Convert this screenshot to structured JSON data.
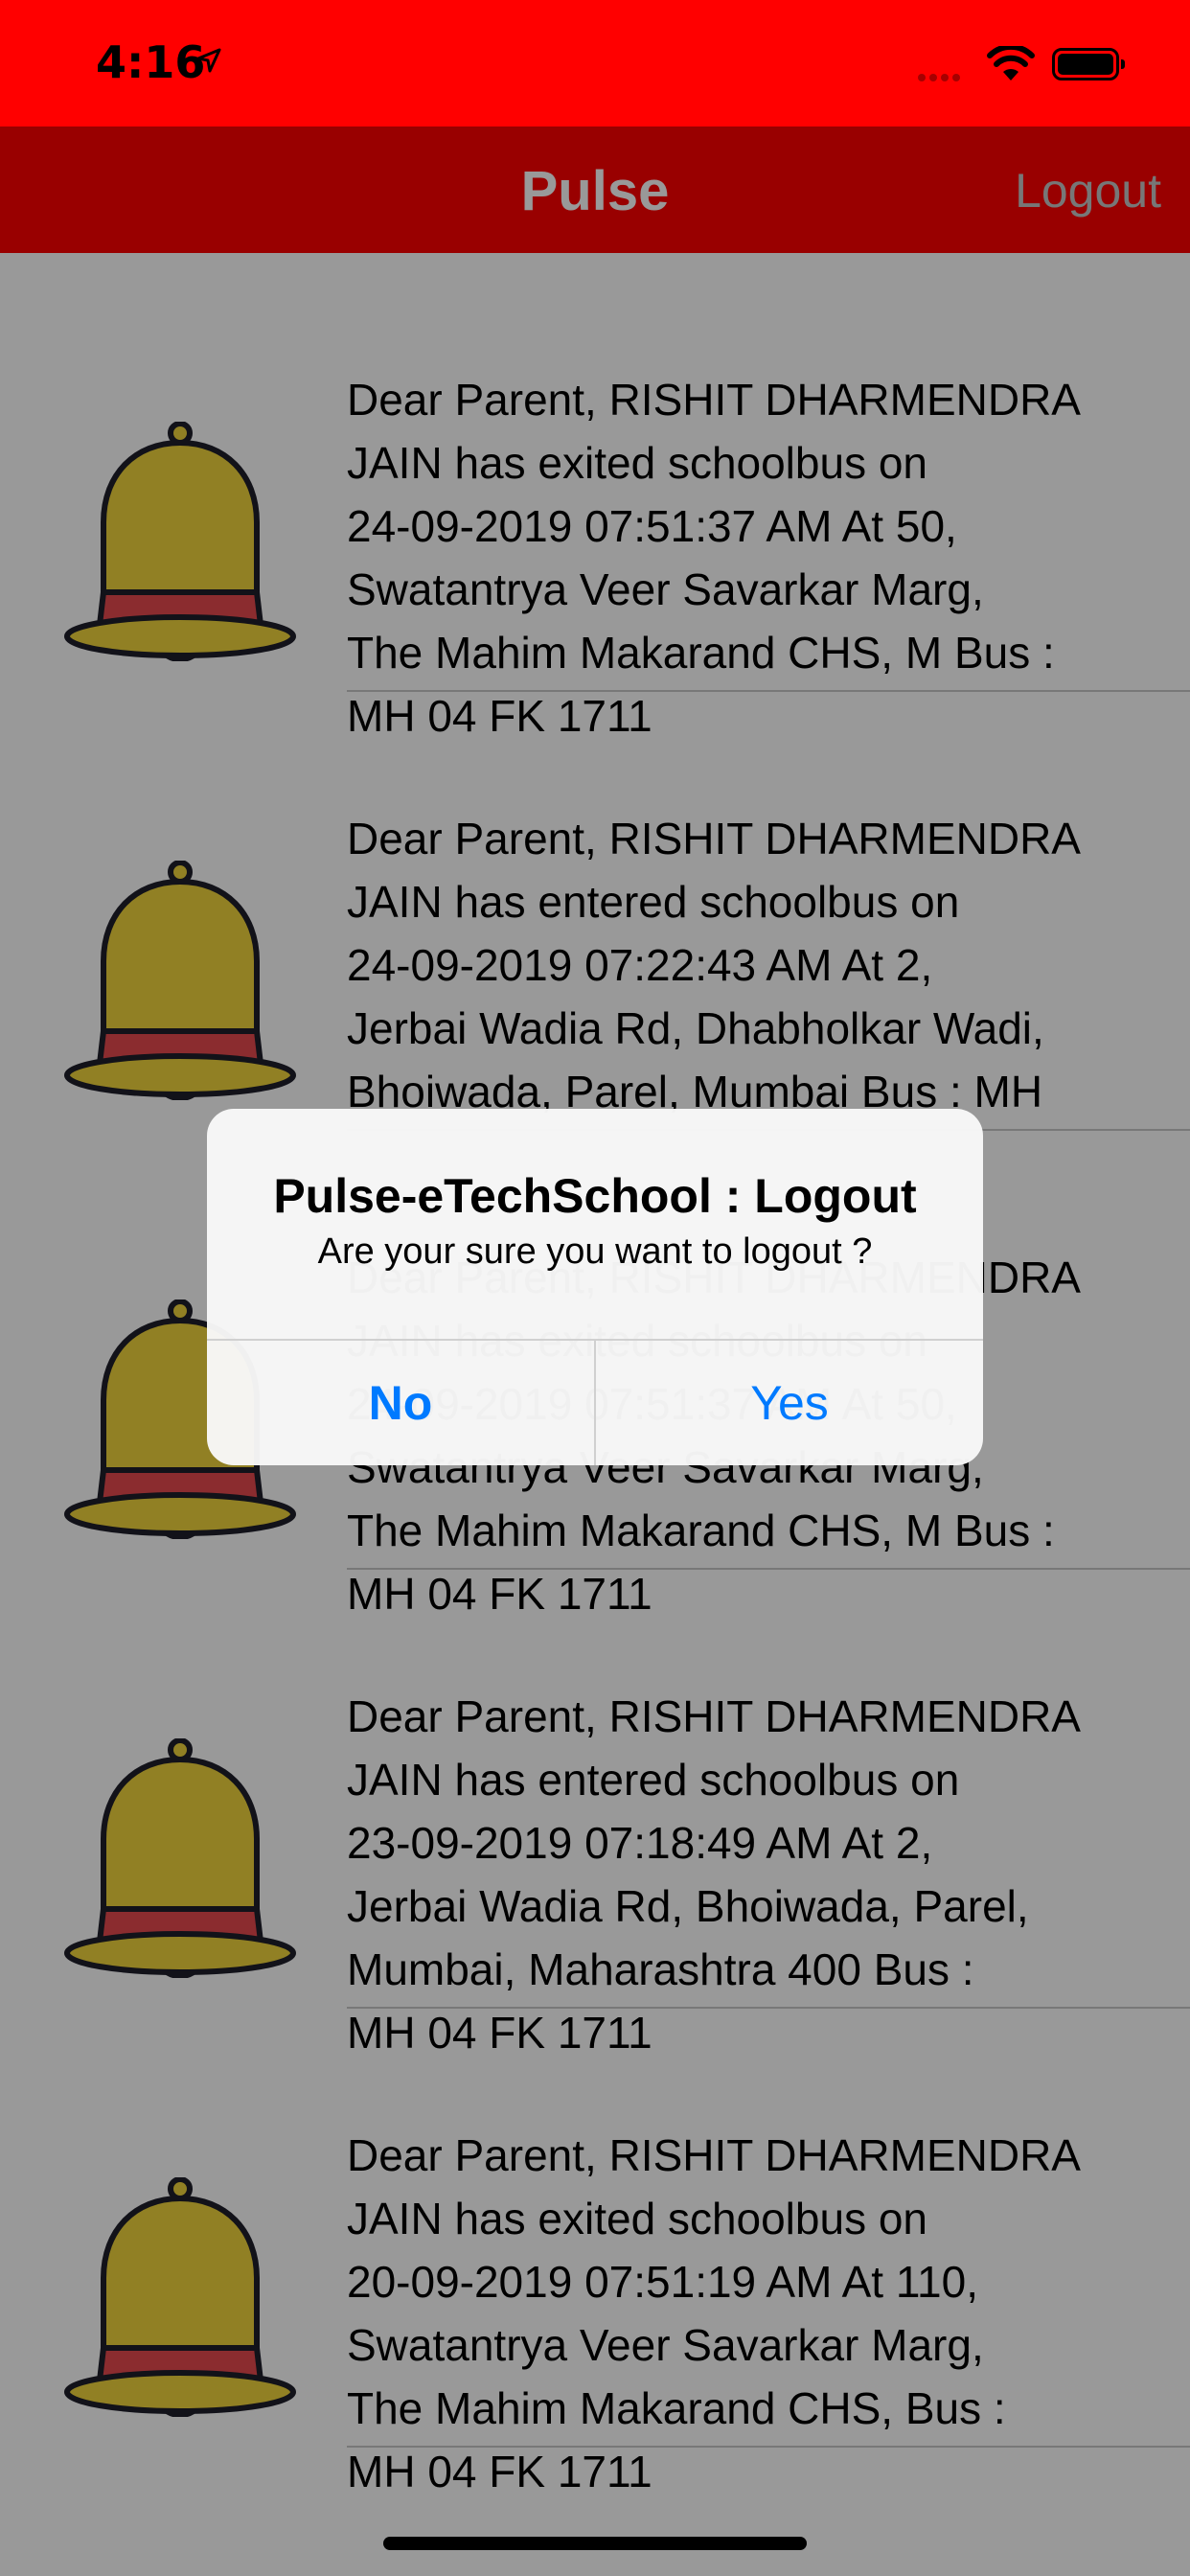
{
  "status_bar": {
    "time": "4:16"
  },
  "nav": {
    "title": "Pulse",
    "logout_label": "Logout"
  },
  "notifications": [
    {
      "icon": "bell-icon",
      "message": "Dear Parent, RISHIT DHARMENDRA\nJAIN has exited schoolbus on\n24-09-2019 07:51:37 AM At 50,\nSwatantrya Veer Savarkar Marg,\nThe Mahim Makarand CHS, M Bus :\nMH 04 FK 1711"
    },
    {
      "icon": "bell-icon",
      "message": "Dear Parent, RISHIT DHARMENDRA\nJAIN has entered schoolbus on\n24-09-2019 07:22:43 AM At 2,\nJerbai Wadia Rd, Dhabholkar Wadi,\nBhoiwada, Parel, Mumbai Bus : MH"
    },
    {
      "icon": "bell-icon",
      "message": "Dear Parent, RISHIT DHARMENDRA\nJAIN has exited schoolbus on\n24-09-2019 07:51:37 AM At 50,\nSwatantrya Veer Savarkar Marg,\nThe Mahim Makarand CHS, M Bus :\nMH 04 FK 1711"
    },
    {
      "icon": "bell-icon",
      "message": "Dear Parent, RISHIT DHARMENDRA\nJAIN has entered schoolbus on\n23-09-2019 07:18:49 AM At 2,\nJerbai Wadia Rd, Bhoiwada, Parel,\nMumbai, Maharashtra 400 Bus :\nMH 04 FK 1711"
    },
    {
      "icon": "bell-icon",
      "message": "Dear Parent, RISHIT DHARMENDRA\nJAIN has exited schoolbus on\n20-09-2019 07:51:19 AM At 110,\nSwatantrya Veer Savarkar Marg,\nThe Mahim Makarand CHS,  Bus :\nMH 04 FK 1711"
    }
  ],
  "alert": {
    "title": "Pulse-eTechSchool : Logout",
    "message": "Are your sure you want to logout ?",
    "no_label": "No",
    "yes_label": "Yes"
  },
  "colors": {
    "status_bar": "#ff0000",
    "nav_bar": "#ff0000",
    "bell_gold": "#f2d53c",
    "bell_band": "#e84a4f",
    "alert_button": "#007aff"
  }
}
